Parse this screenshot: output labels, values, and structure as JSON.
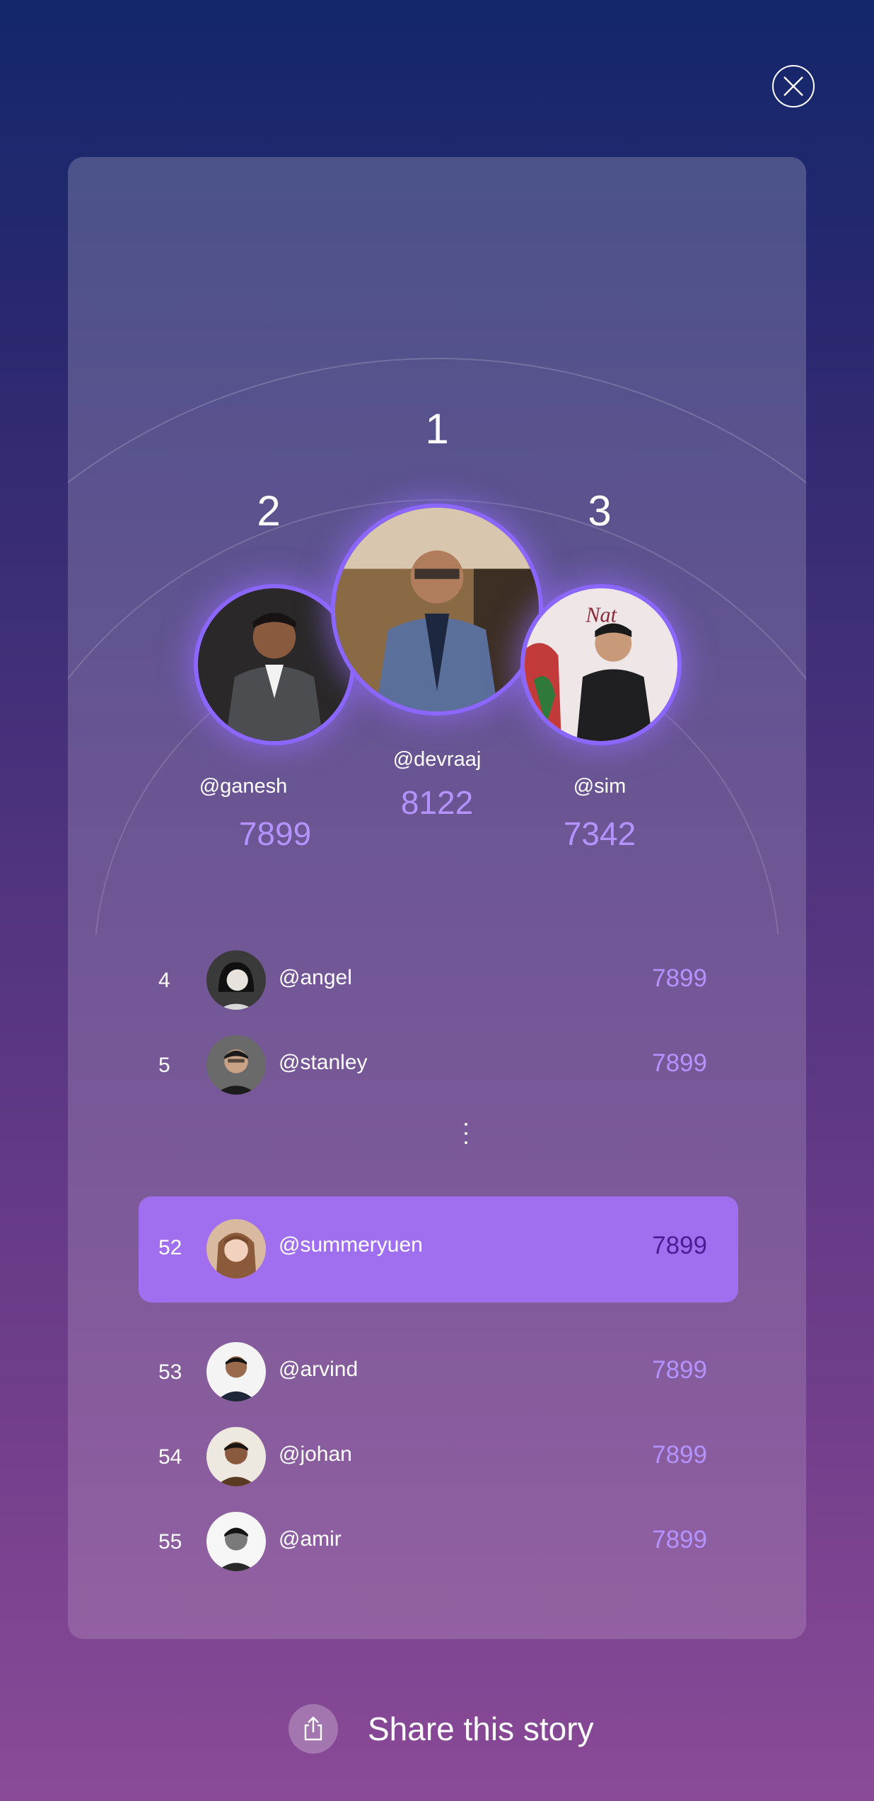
{
  "podium": [
    {
      "rank": "1",
      "handle": "@devraaj",
      "score": "8122"
    },
    {
      "rank": "2",
      "handle": "@ganesh",
      "score": "7899"
    },
    {
      "rank": "3",
      "handle": "@sim",
      "score": "7342"
    }
  ],
  "list_top": [
    {
      "rank": "4",
      "handle": "@angel",
      "score": "7899"
    },
    {
      "rank": "5",
      "handle": "@stanley",
      "score": "7899"
    }
  ],
  "current_user": {
    "rank": "52",
    "handle": "@summeryuen",
    "score": "7899"
  },
  "list_bottom": [
    {
      "rank": "53",
      "handle": "@arvind",
      "score": "7899"
    },
    {
      "rank": "54",
      "handle": "@johan",
      "score": "7899"
    },
    {
      "rank": "55",
      "handle": "@amir",
      "score": "7899"
    }
  ],
  "share": {
    "label": "Share this story"
  },
  "colors": {
    "accent": "#8b66ff",
    "score": "#b493ff",
    "highlight": "#a06ff0",
    "highlight_score": "#4a1d93"
  }
}
